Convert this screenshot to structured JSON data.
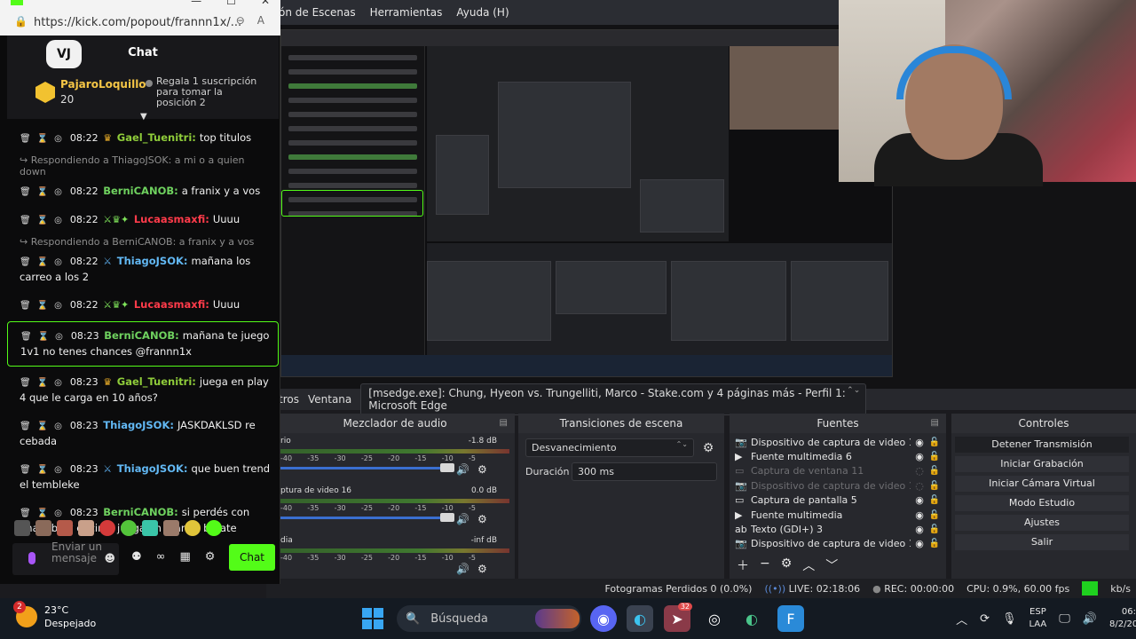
{
  "browser": {
    "url": "https://kick.com/popout/frannn1x/...",
    "tools": [
      "zoom-out-icon",
      "read-aloud-icon"
    ]
  },
  "chat": {
    "title": "Chat",
    "logo": "VJ",
    "pinned": {
      "user": "PajaroLoquillo",
      "amount": "20",
      "message": "Regala 1 suscripción para tomar la posición 2"
    },
    "messages": [
      {
        "type": "msg",
        "time": "08:22",
        "badges": "♛",
        "badge_class": "b-crown",
        "user": "Gael_Tuenitri",
        "user_class": "u-green",
        "text": "top titulos"
      },
      {
        "type": "reply",
        "text": "Respondiendo a ThiagoJSOK: a mi o a quien down"
      },
      {
        "type": "msg",
        "time": "08:22",
        "badges": "",
        "badge_class": "",
        "user": "BerniCANOB",
        "user_class": "u-lime",
        "text": "a franix y a vos"
      },
      {
        "type": "msg",
        "time": "08:22",
        "badges": "⚔♛✦",
        "badge_class": "b-gem",
        "user": "Lucaasmaxfi",
        "user_class": "u-red",
        "text": "Uuuu"
      },
      {
        "type": "reply",
        "text": "Respondiendo a BerniCANOB: a franix y a vos"
      },
      {
        "type": "msg",
        "time": "08:22",
        "badges": "⚔",
        "badge_class": "b-sw",
        "user": "ThiagoJSOK",
        "user_class": "u-blue",
        "text": "mañana los carreo a los 2"
      },
      {
        "type": "msg",
        "time": "08:22",
        "badges": "⚔♛✦",
        "badge_class": "b-gem",
        "user": "Lucaasmaxfi",
        "user_class": "u-red",
        "text": "Uuuu"
      },
      {
        "type": "msg",
        "highlight": true,
        "time": "08:23",
        "badges": "",
        "badge_class": "",
        "user": "BerniCANOB",
        "user_class": "u-lime",
        "text": "mañana te juego 1v1 no tenes chances @frannn1x"
      },
      {
        "type": "msg",
        "time": "08:23",
        "badges": "♛",
        "badge_class": "b-crown",
        "user": "Gael_Tuenitri",
        "user_class": "u-green",
        "text": "juega en play 4 que le carga en 10 años?"
      },
      {
        "type": "msg",
        "time": "08:23",
        "badges": "",
        "badge_class": "",
        "user": "ThiagoJSOK",
        "user_class": "u-blue",
        "text": "JASKDAKLSD re cebada"
      },
      {
        "type": "msg",
        "time": "08:23",
        "badges": "⚔",
        "badge_class": "b-sw",
        "user": "ThiagoJSOK",
        "user_class": "u-blue",
        "text": "que buen trend el tembleke"
      },
      {
        "type": "msg",
        "time": "08:23",
        "badges": "",
        "badge_class": "",
        "user": "BerniCANOB",
        "user_class": "u-lime",
        "text": "si perdés con una piba y encima juega en mando batate"
      }
    ],
    "input_placeholder": "Enviar un mensaje",
    "send_label": "Chat"
  },
  "obs": {
    "menu": [
      "ón de Escenas",
      "Herramientas",
      "Ayuda (H)"
    ],
    "scene_strip": {
      "left_label": "tros",
      "type_label": "Ventana",
      "source": "[msedge.exe]: Chung, Hyeon vs. Trungelliti, Marco - Stake.com y 4 páginas más - Perfil 1: Microsoft Edge"
    },
    "mixer": {
      "title": "Mezclador de audio",
      "ticks": [
        "-40",
        "-35",
        "-30",
        "-25",
        "-20",
        "-15",
        "-10",
        "-5"
      ],
      "channels": [
        {
          "name": "rio",
          "db": "-1.8 dB"
        },
        {
          "name": "ptura de video 16",
          "db": "0.0 dB"
        },
        {
          "name": "dia",
          "db": "-inf dB"
        }
      ]
    },
    "transitions": {
      "title": "Transiciones de escena",
      "selected": "Desvanecimiento",
      "duration_label": "Duración",
      "duration_value": "300 ms"
    },
    "sources": {
      "title": "Fuentes",
      "items": [
        {
          "icon": "📷",
          "name": "Dispositivo de captura de video 16",
          "visible": true
        },
        {
          "icon": "▶",
          "name": "Fuente multimedia 6",
          "visible": true
        },
        {
          "icon": "▭",
          "name": "Captura de ventana 11",
          "visible": false
        },
        {
          "icon": "📷",
          "name": "Dispositivo de captura de video 16",
          "visible": false
        },
        {
          "icon": "▭",
          "name": "Captura de pantalla 5",
          "visible": true
        },
        {
          "icon": "▶",
          "name": "Fuente multimedia",
          "visible": true
        },
        {
          "icon": "ab",
          "name": "Texto (GDI+) 3",
          "visible": true
        },
        {
          "icon": "📷",
          "name": "Dispositivo de captura de video 16",
          "visible": true
        }
      ]
    },
    "controls": {
      "title": "Controles",
      "buttons": [
        "Detener Transmisión",
        "Iniciar Grabación",
        "Iniciar Cámara Virtual",
        "Modo Estudio",
        "Ajustes",
        "Salir"
      ]
    },
    "status": {
      "dropped": "Fotogramas Perdidos 0 (0.0%)",
      "live": "LIVE: 02:18:06",
      "rec": "REC: 00:00:00",
      "cpu": "CPU: 0.9%, 60.00 fps",
      "kbs": "kb/s"
    }
  },
  "taskbar": {
    "temp": "23°C",
    "weather": "Despejado",
    "weather_badge": "2",
    "search_label": "Búsqueda",
    "notif_count": "32",
    "lang_top": "ESP",
    "lang_bottom": "LAA",
    "time": "06:",
    "date": "8/2/20"
  }
}
